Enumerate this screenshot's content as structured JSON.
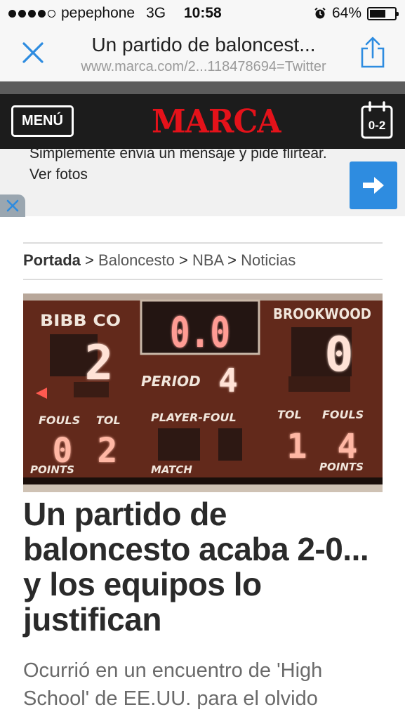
{
  "status_bar": {
    "carrier": "pepephone",
    "network": "3G",
    "time": "10:58",
    "battery": "64%",
    "battery_level": 0.64
  },
  "browser": {
    "page_title": "Un partido de baloncest...",
    "url": "www.marca.com/2...118478694=Twitter"
  },
  "site": {
    "menu_label": "MENÚ",
    "logo": "MARCA",
    "score_icon_label": "0-2"
  },
  "ad": {
    "text": "Simplemente envia un mensaje y pide flirtear. Ver fotos"
  },
  "breadcrumb": {
    "items": [
      "Portada",
      "Baloncesto",
      "NBA",
      "Noticias"
    ],
    "separator": ">"
  },
  "scoreboard": {
    "home_team": "BIBB CO",
    "away_team": "BROOKWOOD",
    "clock": "0.0",
    "home_score": "2",
    "away_score": "0",
    "period_label": "PERIOD",
    "period": "4",
    "fouls_label": "FOULS",
    "tol_label": "TOL",
    "player_foul_label": "PLAYER-FOUL",
    "home_fouls": "0",
    "home_tol": "2",
    "away_tol": "1",
    "away_fouls": "4",
    "points_label": "POINTS",
    "match_label": "MATCH"
  },
  "article": {
    "headline": "Un partido de baloncesto acaba 2-0... y los equipos lo justifican",
    "subheadline": "Ocurrió en un encuentro de 'High School' de EE.UU. para el olvido"
  },
  "colors": {
    "brand_red": "#e4121a",
    "ios_blue": "#2e8ce0",
    "header_bg": "#1c1c1c"
  }
}
